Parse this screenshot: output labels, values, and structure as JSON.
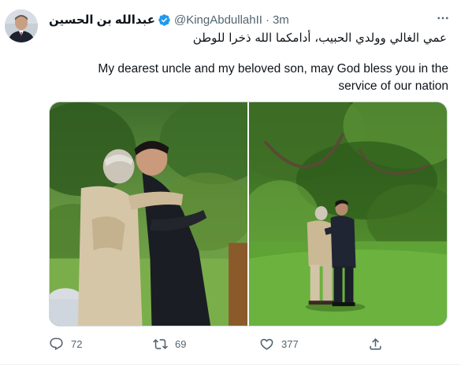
{
  "tweet": {
    "author": {
      "display_name": "عبدالله بن الحسين",
      "verified": true,
      "handle": "@KingAbdullahII",
      "separator": "·",
      "time": "3m"
    },
    "text_arabic": "عمي الغالي وولدي الحبيب، أدامكما الله ذخرا للوطن",
    "text_english": "My dearest uncle and my beloved son, may God bless you in the service of our nation",
    "media": [
      {
        "icon": "photo-embrace"
      },
      {
        "icon": "photo-garden-walk"
      }
    ],
    "actions": {
      "reply_count": "72",
      "retweet_count": "69",
      "like_count": "377"
    }
  },
  "colors": {
    "text_primary": "#0f1419",
    "text_secondary": "#536471",
    "verified_blue": "#1d9bf0",
    "border": "#cfd9de"
  }
}
